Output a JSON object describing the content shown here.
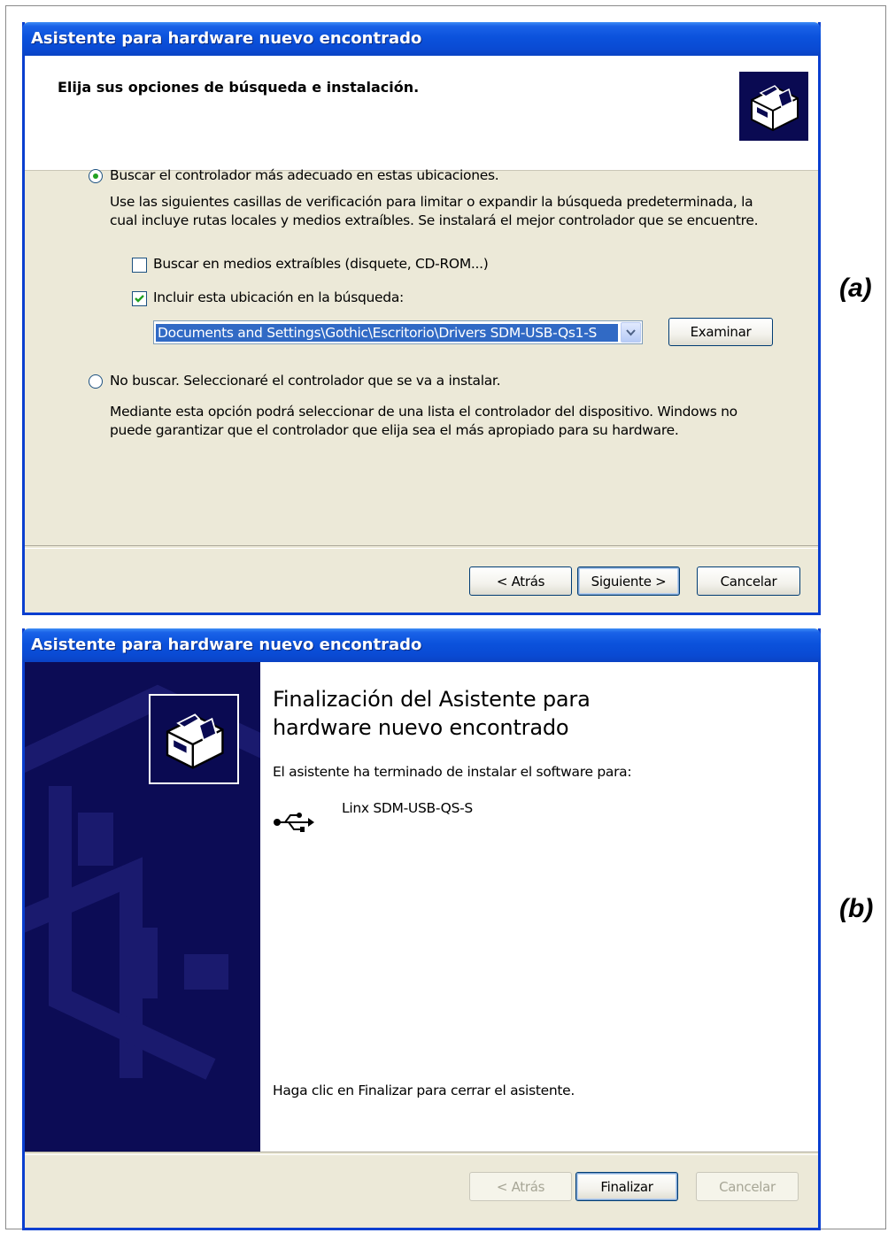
{
  "window_a": {
    "title": "Asistente para hardware nuevo encontrado",
    "header_title": "Elija sus opciones de búsqueda e instalación.",
    "header_icon": "hardware-wizard-icon",
    "option_search": {
      "label": "Buscar el controlador más adecuado en estas ubicaciones.",
      "selected": true,
      "description_line1": "Use las siguientes casillas de verificación para limitar o expandir la búsqueda predeterminada, la",
      "description_line2": "cual incluye rutas locales y medios extraíbles. Se instalará el mejor controlador que se encuentre."
    },
    "checkbox_removable": {
      "label": "Buscar en medios extraíbles (disquete, CD-ROM...)",
      "checked": false
    },
    "checkbox_include_location": {
      "label": "Incluir esta ubicación en la búsqueda:",
      "checked": true
    },
    "location_value": "Documents and Settings\\Gothic\\Escritorio\\Drivers SDM-USB-Qs1-S",
    "browse_button": "Examinar",
    "option_no_search": {
      "label": "No buscar. Seleccionaré el controlador que se va a instalar.",
      "selected": false,
      "description_line1": "Mediante esta opción podrá seleccionar de una lista el controlador del dispositivo. Windows no",
      "description_line2": "puede garantizar que el controlador que elija sea el más apropiado para su hardware."
    },
    "buttons": {
      "back": "< Atrás",
      "next": "Siguiente >",
      "cancel": "Cancelar"
    },
    "side_label": "(a)"
  },
  "window_b": {
    "title": "Asistente para hardware nuevo encontrado",
    "heading_line1": "Finalización del Asistente para",
    "heading_line2": "hardware nuevo encontrado",
    "finished_text": "El asistente ha terminado de instalar el software para:",
    "device_icon": "usb-icon",
    "device_name": "Linx SDM-USB-QS-S",
    "close_hint": "Haga clic en Finalizar para cerrar el asistente.",
    "buttons": {
      "back": "< Atrás",
      "finish": "Finalizar",
      "cancel": "Cancelar"
    },
    "side_label": "(b)"
  },
  "colors": {
    "titlebar": "#0a4ad3",
    "dialog_face": "#ece9d8",
    "selection": "#316ac5",
    "wizard_panel": "#0c0c55"
  }
}
